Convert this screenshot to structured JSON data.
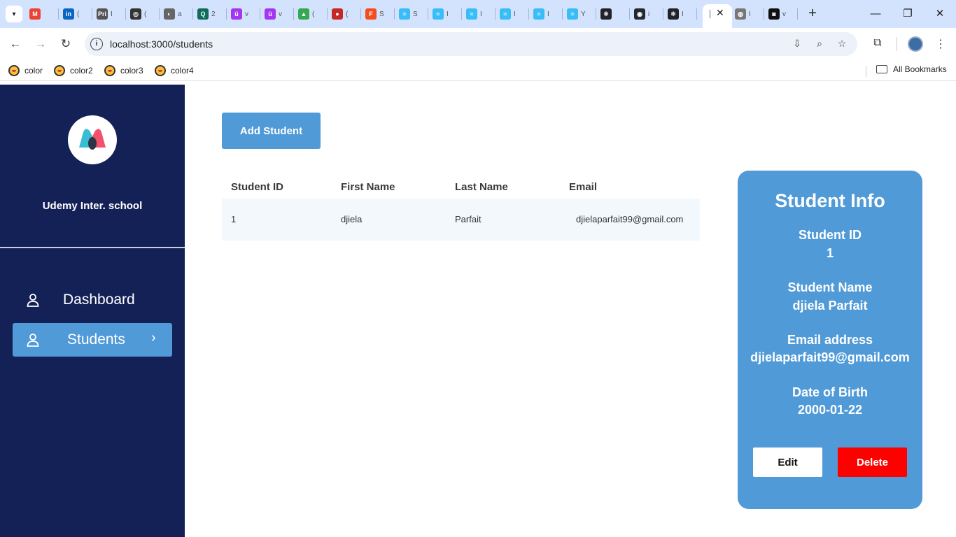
{
  "browser": {
    "tabs": [
      {
        "icon": "gmail-icon",
        "letter": "M",
        "color": "#ea4335",
        "cut": ""
      },
      {
        "icon": "linkedin-icon",
        "letter": "in",
        "color": "#0a66c2",
        "cut": "("
      },
      {
        "icon": "print-icon",
        "letter": "Pri",
        "color": "#555555",
        "cut": "I"
      },
      {
        "icon": "openai-icon",
        "letter": "◎",
        "color": "#333333",
        "cut": "("
      },
      {
        "icon": "globe-icon",
        "letter": "◐",
        "color": "#666666",
        "cut": "a"
      },
      {
        "icon": "quizlet-icon",
        "letter": "Q",
        "color": "#0f6b5c",
        "cut": "2"
      },
      {
        "icon": "udemy-icon",
        "letter": "ü",
        "color": "#a435f0",
        "cut": "v"
      },
      {
        "icon": "udemy-icon",
        "letter": "ü",
        "color": "#a435f0",
        "cut": "v"
      },
      {
        "icon": "drive-icon",
        "letter": "▲",
        "color": "#34a853",
        "cut": "("
      },
      {
        "icon": "record-icon",
        "letter": "●",
        "color": "#c62828",
        "cut": "("
      },
      {
        "icon": "figma-icon",
        "letter": "F",
        "color": "#f24e1e",
        "cut": "S"
      },
      {
        "icon": "tailwind-icon",
        "letter": "≈",
        "color": "#38bdf8",
        "cut": "S"
      },
      {
        "icon": "tailwind-icon",
        "letter": "≈",
        "color": "#38bdf8",
        "cut": "I"
      },
      {
        "icon": "tailwind-icon",
        "letter": "≈",
        "color": "#38bdf8",
        "cut": "I"
      },
      {
        "icon": "tailwind-icon",
        "letter": "≈",
        "color": "#38bdf8",
        "cut": "I"
      },
      {
        "icon": "tailwind-icon",
        "letter": "≈",
        "color": "#38bdf8",
        "cut": "I"
      },
      {
        "icon": "tailwind-icon",
        "letter": "≈",
        "color": "#38bdf8",
        "cut": "Y"
      },
      {
        "icon": "react-icon",
        "letter": "⚛",
        "color": "#20232a",
        "cut": ""
      },
      {
        "icon": "github-icon",
        "letter": "◉",
        "color": "#24292f",
        "cut": "i"
      },
      {
        "icon": "react-icon",
        "letter": "⚛",
        "color": "#20232a",
        "cut": "I"
      },
      {
        "icon": "chrome-icon",
        "letter": "◍",
        "color": "#777777",
        "cut": "I"
      },
      {
        "icon": "bot-icon",
        "letter": "◙",
        "color": "#111111",
        "cut": "v"
      }
    ],
    "url": "localhost:3000/students",
    "bookmarks": [
      "color",
      "color2",
      "color3",
      "color4"
    ],
    "all_bookmarks": "All Bookmarks"
  },
  "sidebar": {
    "school_name": "Udemy Inter. school",
    "nav": [
      {
        "label": "Dashboard",
        "icon": "user-icon"
      },
      {
        "label": "Students",
        "icon": "user-icon",
        "active": true
      }
    ]
  },
  "main": {
    "add_button": "Add Student",
    "table": {
      "headers": [
        "Student ID",
        "First Name",
        "Last Name",
        "Email"
      ],
      "rows": [
        {
          "id": "1",
          "first": "djiela",
          "last": "Parfait",
          "email": "djielaparfait99@gmail.com"
        }
      ]
    }
  },
  "info": {
    "title": "Student Info",
    "id_label": "Student ID",
    "id_value": "1",
    "name_label": "Student Name",
    "name_value": "djiela Parfait",
    "email_label": "Email address",
    "email_value": "djielaparfait99@gmail.com",
    "dob_label": "Date of Birth",
    "dob_value": "2000-01-22",
    "edit": "Edit",
    "delete": "Delete"
  },
  "colors": {
    "sidebar": "#142157",
    "accent": "#509ad8",
    "danger": "#ff0000"
  }
}
